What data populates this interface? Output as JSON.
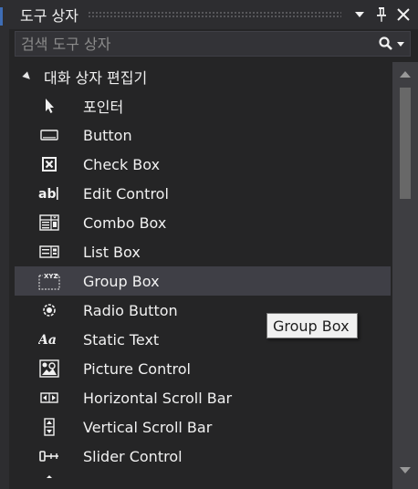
{
  "window": {
    "title": "도구 상자",
    "pin_icon": "pin-icon",
    "close_icon": "close-icon",
    "menu_icon": "dropdown-arrow-icon"
  },
  "search": {
    "placeholder": "검색 도구 상자",
    "value": "",
    "icon": "search-icon"
  },
  "group": {
    "label": "대화 상자 편집기",
    "expanded": true
  },
  "items": [
    {
      "label": "포인터",
      "icon": "pointer-icon"
    },
    {
      "label": "Button",
      "icon": "button-icon"
    },
    {
      "label": "Check Box",
      "icon": "checkbox-icon"
    },
    {
      "label": "Edit Control",
      "icon": "edit-control-icon"
    },
    {
      "label": "Combo Box",
      "icon": "combo-box-icon"
    },
    {
      "label": "List Box",
      "icon": "list-box-icon"
    },
    {
      "label": "Group Box",
      "icon": "group-box-icon",
      "selected": true
    },
    {
      "label": "Radio Button",
      "icon": "radio-button-icon"
    },
    {
      "label": "Static Text",
      "icon": "static-text-icon"
    },
    {
      "label": "Picture Control",
      "icon": "picture-control-icon"
    },
    {
      "label": "Horizontal Scroll Bar",
      "icon": "horizontal-scrollbar-icon"
    },
    {
      "label": "Vertical Scroll Bar",
      "icon": "vertical-scrollbar-icon"
    },
    {
      "label": "Slider Control",
      "icon": "slider-control-icon"
    }
  ],
  "tooltip": {
    "text": "Group Box"
  },
  "colors": {
    "background": "#252526",
    "titlebar": "#2d2d30",
    "selected_row": "#3f3f46",
    "scrollbar_track": "#3e3e42",
    "scrollbar_thumb": "#686868",
    "text": "#f1f1f1"
  }
}
